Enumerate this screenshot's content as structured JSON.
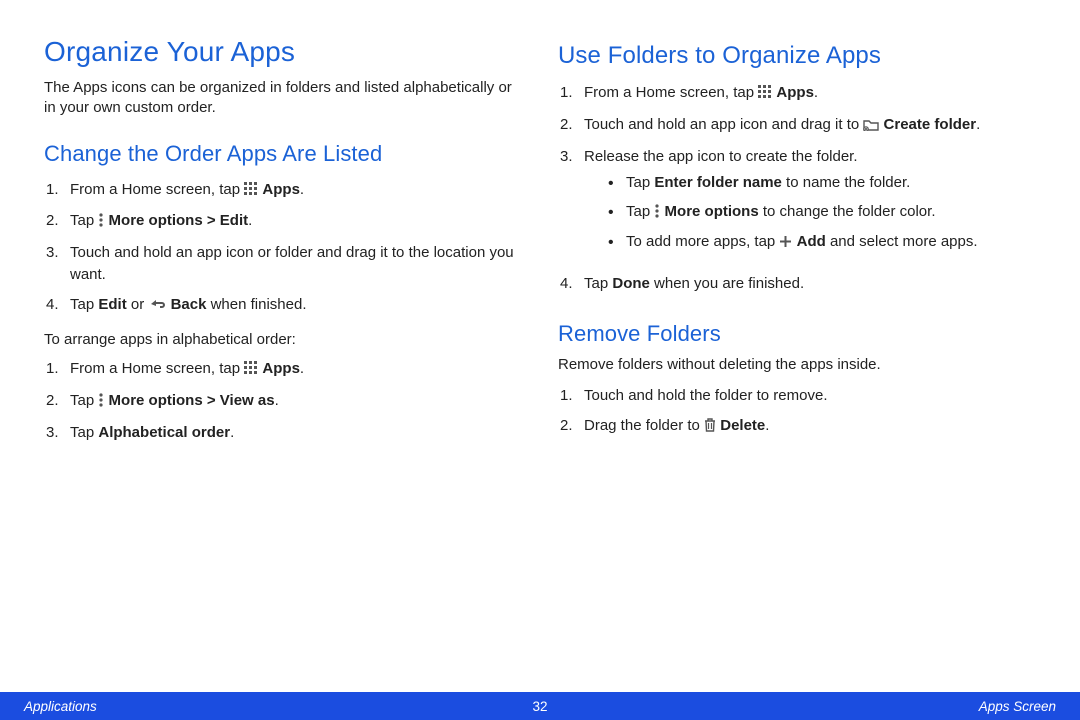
{
  "left": {
    "h1": "Organize Your Apps",
    "intro": "The Apps icons can be organized in folders and listed alphabetically or in your own custom order.",
    "h2a": "Change the Order Apps Are Listed",
    "s1_pre": "From a Home screen, tap ",
    "s1_bold": "Apps",
    "s1_post": ".",
    "s2_pre": "Tap ",
    "s2_bold": "More options > Edit",
    "s2_post": ".",
    "s3": "Touch and hold an app icon or folder and drag it to the location you want.",
    "s4_pre": "Tap ",
    "s4_b1": "Edit",
    "s4_mid": " or ",
    "s4_b2": "Back",
    "s4_post": " when finished.",
    "between": "To arrange apps in alphabetical order:",
    "t1_pre": "From a Home screen, tap ",
    "t1_bold": "Apps",
    "t1_post": ".",
    "t2_pre": "Tap ",
    "t2_bold": "More options > View as",
    "t2_post": ".",
    "t3_pre": "Tap ",
    "t3_bold": "Alphabetical order",
    "t3_post": "."
  },
  "right": {
    "h2a": "Use Folders to Organize Apps",
    "u1_pre": "From a Home screen, tap ",
    "u1_bold": "Apps",
    "u1_post": ".",
    "u2_pre": "Touch and hold an app icon and drag it to ",
    "u2_bold": "Create folder",
    "u2_post": ".",
    "u3": "Release the app icon to create the folder.",
    "b1_pre": "Tap ",
    "b1_bold": "Enter folder name",
    "b1_post": " to name the folder.",
    "b2_pre": "Tap ",
    "b2_bold": "More options",
    "b2_post": " to change the folder color.",
    "b3_pre": "To add more apps, tap ",
    "b3_bold": "Add",
    "b3_post": " and select more apps.",
    "u4_pre": "Tap ",
    "u4_bold": "Done",
    "u4_post": " when you are finished.",
    "h2b": "Remove Folders",
    "rintro": "Remove folders without deleting the apps inside.",
    "r1": "Touch and hold the folder to remove.",
    "r2_pre": "Drag the folder to ",
    "r2_bold": "Delete",
    "r2_post": "."
  },
  "footer": {
    "left": "Applications",
    "center": "32",
    "right": "Apps Screen"
  }
}
